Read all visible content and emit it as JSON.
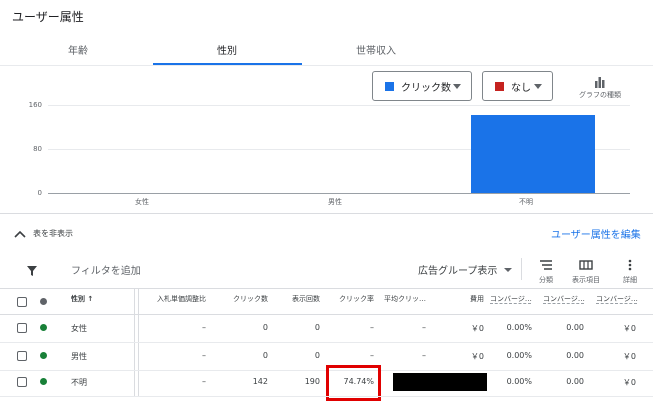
{
  "section_title": "ユーザー属性",
  "tabs": [
    {
      "label": "年齢",
      "active": false
    },
    {
      "label": "性別",
      "active": true
    },
    {
      "label": "世帯収入",
      "active": false
    }
  ],
  "metric_select": {
    "label": "クリック数",
    "color": "#1a73e8"
  },
  "compare_select": {
    "label": "なし",
    "color": "#c5221f"
  },
  "chart_type_label": "グラフの種類",
  "chart_data": {
    "type": "bar",
    "categories": [
      "女性",
      "男性",
      "不明"
    ],
    "values": [
      0,
      0,
      142
    ],
    "yticks": [
      "160",
      "80",
      "0"
    ],
    "ylim": [
      0,
      160
    ],
    "bar_color": "#1a73e8",
    "grid": true
  },
  "hide_table_label": "表を非表示",
  "edit_demographics_link": "ユーザー属性を編集",
  "toolbar": {
    "add_filter": "フィルタを追加",
    "view_select": "広告グループ表示",
    "segment": "分類",
    "columns": "表示項目",
    "details": "詳細"
  },
  "table": {
    "headers": [
      "性別",
      "入札単価調整比",
      "クリック数",
      "表示回数",
      "クリック率",
      "平均クリッ…",
      "費用",
      "コンバージ…",
      "コンバージ…",
      "コンバージ…"
    ],
    "rows": [
      {
        "gender": "女性",
        "bid_adj": "–",
        "clicks": "0",
        "impr": "0",
        "ctr": "–",
        "avg_cpc": "–",
        "cost": "￥0",
        "conv_rate": "0.00%",
        "conv": "0.00",
        "cost_conv": "￥0",
        "status_color": "#188038"
      },
      {
        "gender": "男性",
        "bid_adj": "–",
        "clicks": "0",
        "impr": "0",
        "ctr": "–",
        "avg_cpc": "–",
        "cost": "￥0",
        "conv_rate": "0.00%",
        "conv": "0.00",
        "cost_conv": "￥0",
        "status_color": "#188038"
      },
      {
        "gender": "不明",
        "bid_adj": "–",
        "clicks": "142",
        "impr": "190",
        "ctr": "74.74%",
        "avg_cpc": "",
        "cost": "",
        "conv_rate": "0.00%",
        "conv": "0.00",
        "cost_conv": "￥0",
        "status_color": "#188038"
      }
    ]
  },
  "highlight_color": "#e00000"
}
